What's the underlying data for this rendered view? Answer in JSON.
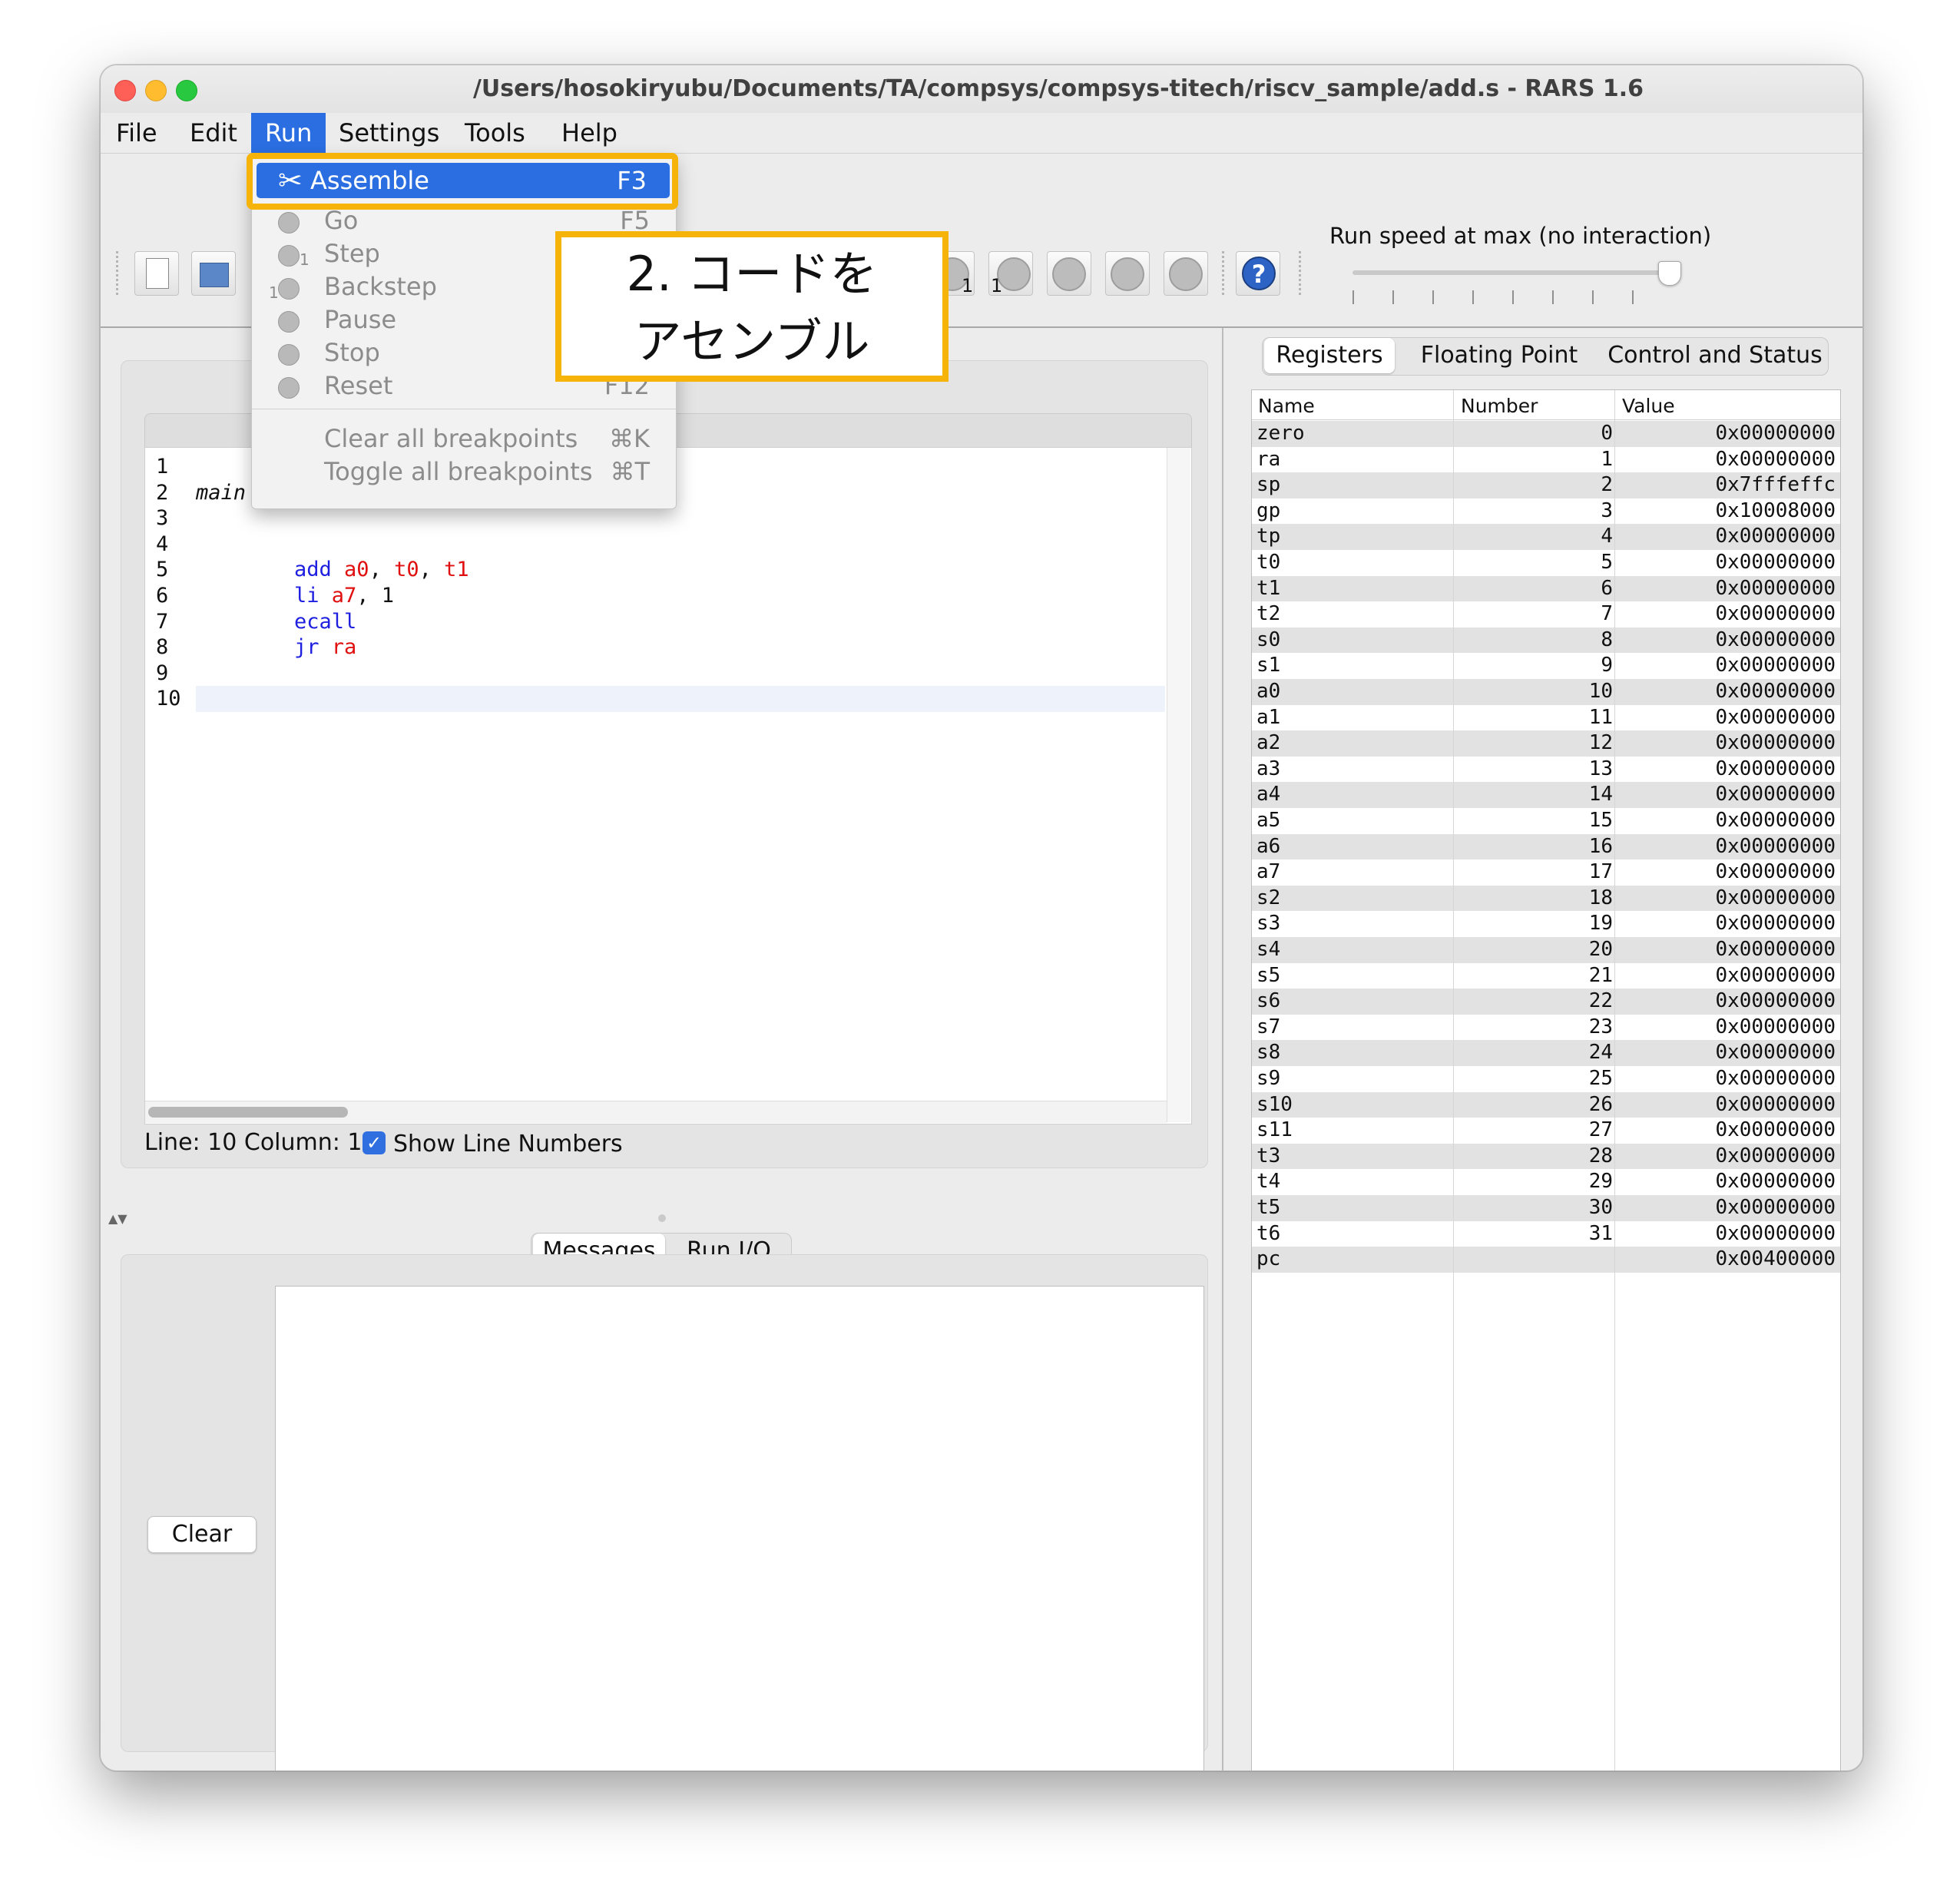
{
  "window": {
    "title": "/Users/hosokiryubu/Documents/TA/compsys/compsys-titech/riscv_sample/add.s  - RARS 1.6",
    "traffic_light_colors": [
      "#fe5f57",
      "#febc2e",
      "#28c840"
    ]
  },
  "menubar": {
    "file": "File",
    "edit": "Edit",
    "run": "Run",
    "settings": "Settings",
    "tools": "Tools",
    "help": "Help"
  },
  "run_menu": {
    "assemble": {
      "label": "Assemble",
      "shortcut": "F3"
    },
    "go": {
      "label": "Go",
      "shortcut": "F5"
    },
    "step": {
      "label": "Step",
      "sub": "1"
    },
    "backstep": {
      "label": "Backstep",
      "sub": "1"
    },
    "pause": {
      "label": "Pause"
    },
    "stop": {
      "label": "Stop"
    },
    "reset": {
      "label": "Reset",
      "shortcut": "F12"
    },
    "clear_breakpoints": {
      "label": "Clear all breakpoints",
      "shortcut": "⌘K"
    },
    "toggle_breakpoints": {
      "label": "Toggle all breakpoints",
      "shortcut": "⌘T"
    }
  },
  "callout": {
    "line1": "2. コードを",
    "line2": "アセンブル",
    "border_color": "#f6b40b"
  },
  "toolbar": {
    "run_speed_label": "Run speed at max (no interaction)",
    "step_sub": "1",
    "backstep_sub": "1",
    "run_speed_level": 1.0
  },
  "editor": {
    "line_numbers": [
      "1",
      "2",
      "3",
      "4",
      "5",
      "6",
      "7",
      "8",
      "9",
      "10"
    ],
    "code": {
      "label": "main",
      "line5": {
        "op": "add",
        "args": [
          " a0",
          ", ",
          "t0",
          ", ",
          "t1"
        ]
      },
      "line6": {
        "op": "li",
        "reg": " a7",
        "rest": ", 1"
      },
      "line7": {
        "op": "ecall"
      },
      "line8": {
        "op": "jr",
        "reg": " ra"
      }
    },
    "status": "Line: 10 Column: 1",
    "show_line_numbers_label": "Show Line Numbers",
    "show_line_numbers_checked": true
  },
  "bottom_panel": {
    "tabs": [
      "Messages",
      "Run I/O"
    ],
    "clear_button": "Clear"
  },
  "registers_panel": {
    "tabs": [
      "Registers",
      "Floating Point",
      "Control and Status"
    ],
    "columns": [
      "Name",
      "Number",
      "Value"
    ],
    "rows": [
      [
        "zero",
        "0",
        "0x00000000"
      ],
      [
        "ra",
        "1",
        "0x00000000"
      ],
      [
        "sp",
        "2",
        "0x7fffeffc"
      ],
      [
        "gp",
        "3",
        "0x10008000"
      ],
      [
        "tp",
        "4",
        "0x00000000"
      ],
      [
        "t0",
        "5",
        "0x00000000"
      ],
      [
        "t1",
        "6",
        "0x00000000"
      ],
      [
        "t2",
        "7",
        "0x00000000"
      ],
      [
        "s0",
        "8",
        "0x00000000"
      ],
      [
        "s1",
        "9",
        "0x00000000"
      ],
      [
        "a0",
        "10",
        "0x00000000"
      ],
      [
        "a1",
        "11",
        "0x00000000"
      ],
      [
        "a2",
        "12",
        "0x00000000"
      ],
      [
        "a3",
        "13",
        "0x00000000"
      ],
      [
        "a4",
        "14",
        "0x00000000"
      ],
      [
        "a5",
        "15",
        "0x00000000"
      ],
      [
        "a6",
        "16",
        "0x00000000"
      ],
      [
        "a7",
        "17",
        "0x00000000"
      ],
      [
        "s2",
        "18",
        "0x00000000"
      ],
      [
        "s3",
        "19",
        "0x00000000"
      ],
      [
        "s4",
        "20",
        "0x00000000"
      ],
      [
        "s5",
        "21",
        "0x00000000"
      ],
      [
        "s6",
        "22",
        "0x00000000"
      ],
      [
        "s7",
        "23",
        "0x00000000"
      ],
      [
        "s8",
        "24",
        "0x00000000"
      ],
      [
        "s9",
        "25",
        "0x00000000"
      ],
      [
        "s10",
        "26",
        "0x00000000"
      ],
      [
        "s11",
        "27",
        "0x00000000"
      ],
      [
        "t3",
        "28",
        "0x00000000"
      ],
      [
        "t4",
        "29",
        "0x00000000"
      ],
      [
        "t5",
        "30",
        "0x00000000"
      ],
      [
        "t6",
        "31",
        "0x00000000"
      ],
      [
        "pc",
        "",
        "0x00400000"
      ]
    ]
  }
}
